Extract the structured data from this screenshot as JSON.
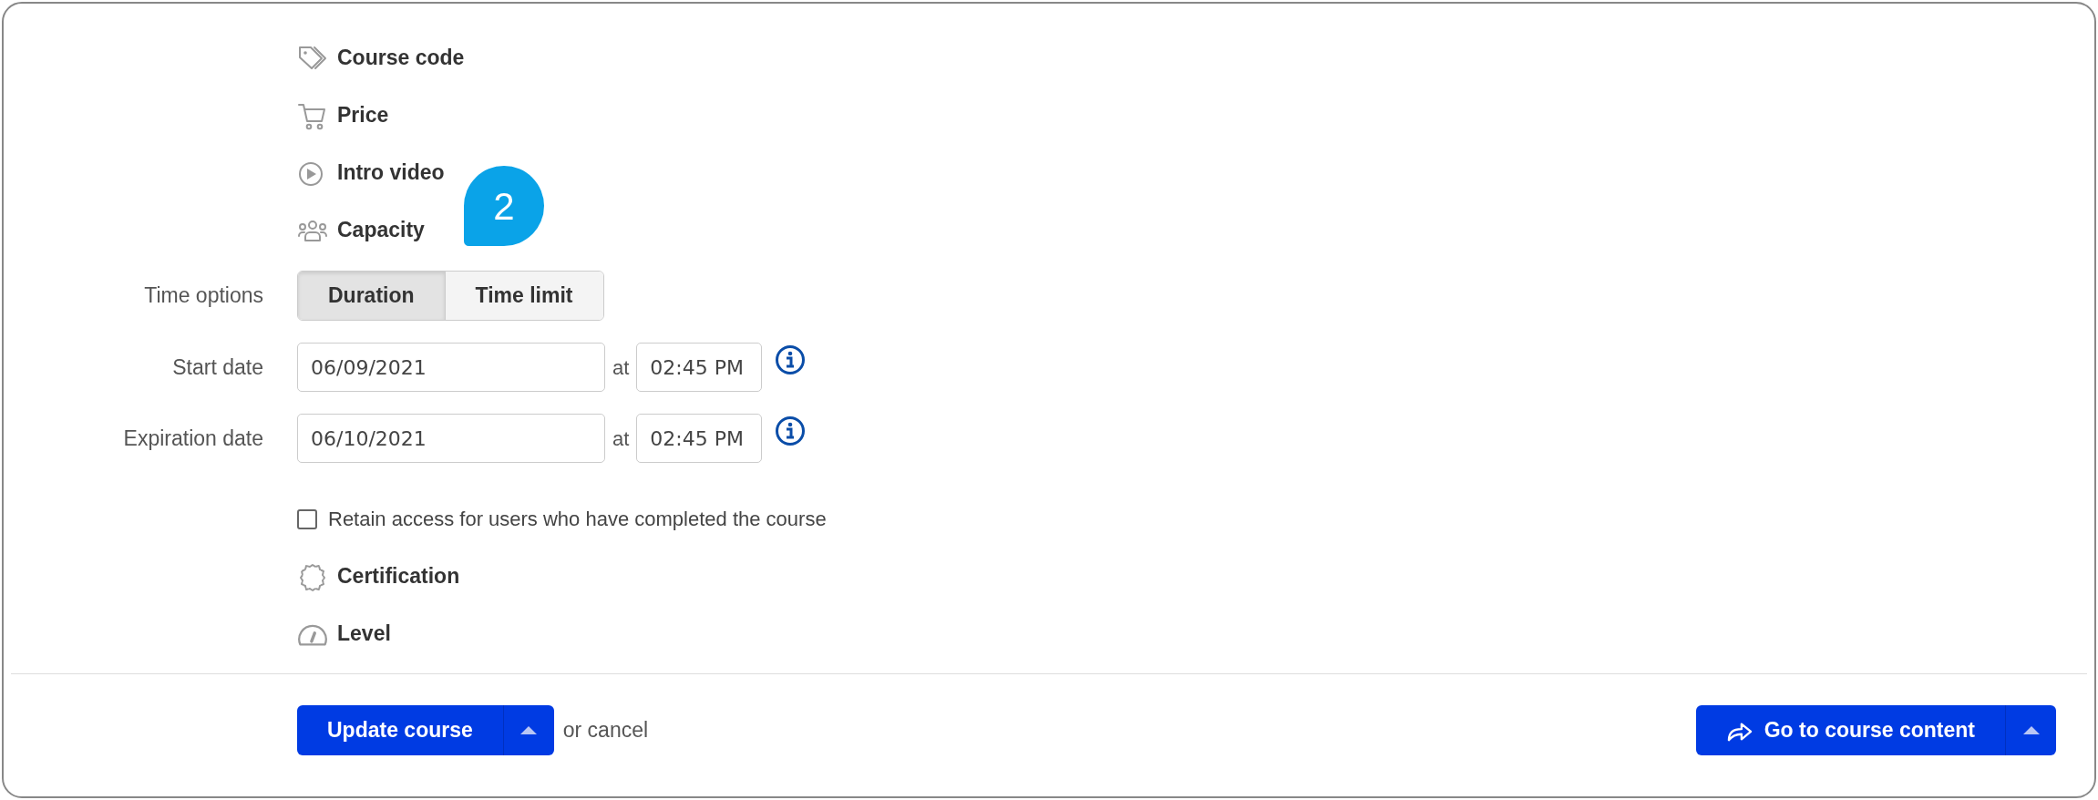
{
  "features": [
    {
      "kind": "tag",
      "label": "Course code"
    },
    {
      "kind": "cart",
      "label": "Price"
    },
    {
      "kind": "play",
      "label": "Intro video"
    },
    {
      "kind": "people",
      "label": "Capacity"
    }
  ],
  "callout": {
    "label": "2"
  },
  "time_options": {
    "label": "Time options",
    "tabs": [
      {
        "label": "Duration",
        "selected": true
      },
      {
        "label": "Time limit",
        "selected": false
      }
    ]
  },
  "dates": [
    {
      "label": "Start date",
      "date": "06/09/2021",
      "at": "at",
      "time": "02:45 PM"
    },
    {
      "label": "Expiration date",
      "date": "06/10/2021",
      "at": "at",
      "time": "02:45 PM"
    }
  ],
  "retain_access": {
    "label": "Retain access for users who have completed the course",
    "checked": false
  },
  "extras": [
    {
      "kind": "badge",
      "label": "Certification"
    },
    {
      "kind": "gauge",
      "label": "Level"
    }
  ],
  "footer": {
    "primary": "Update course",
    "cancel": "or cancel",
    "content_button": "Go to course content"
  }
}
